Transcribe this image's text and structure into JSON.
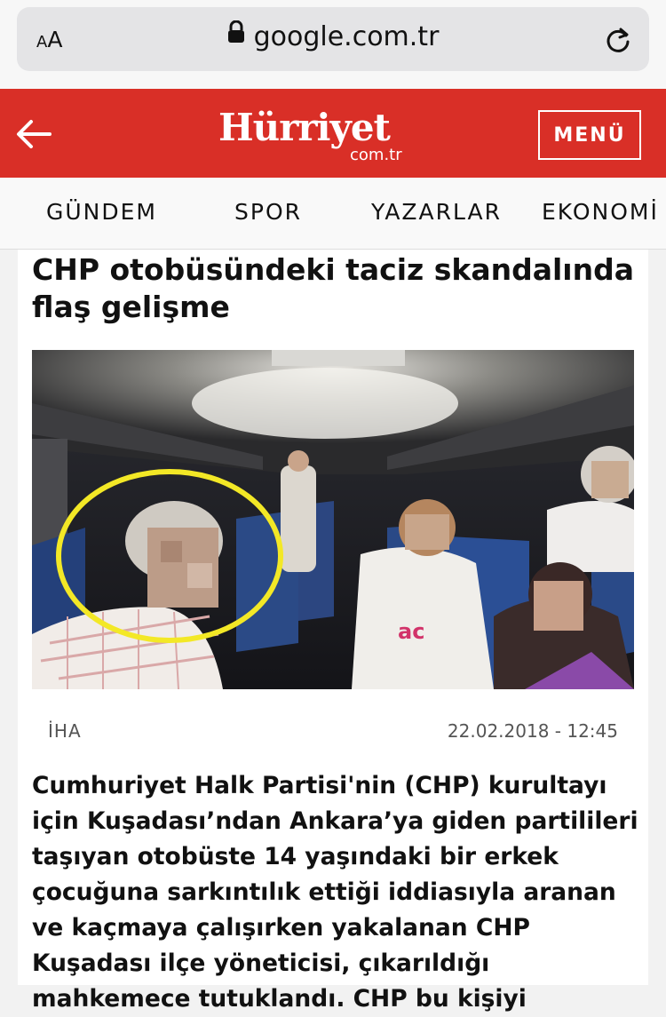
{
  "browser": {
    "text_size_label_small": "A",
    "text_size_label_large": "A",
    "url": "google.com.tr"
  },
  "header": {
    "logo_text": "Hürriyet",
    "logo_domain": "com.tr",
    "menu_label": "MENÜ",
    "brand_color": "#d92f27"
  },
  "nav": {
    "items": [
      {
        "label": "GÜNDEM"
      },
      {
        "label": "SPOR"
      },
      {
        "label": "YAZARLAR"
      },
      {
        "label": "EKONOMİ"
      }
    ]
  },
  "article": {
    "title": "CHP otobüsündeki taciz skandalında flaş gelişme",
    "source": "İHA",
    "date": "22.02.2018 - 12:45",
    "body": "Cumhuriyet Halk Partisi'nin (CHP) kurultayı için Kuşadası’ndan Ankara’ya giden partilileri taşıyan otobüste 14 yaşındaki bir erkek çocuğuna sarkıntılık ettiği iddiasıyla aranan ve kaçmaya çalışırken yakalanan CHP Kuşadası ilçe yöneticisi, çıkarıldığı mahkemece tutuklandı. CHP bu kişiyi",
    "photo_highlight_color": "#f3e826"
  }
}
